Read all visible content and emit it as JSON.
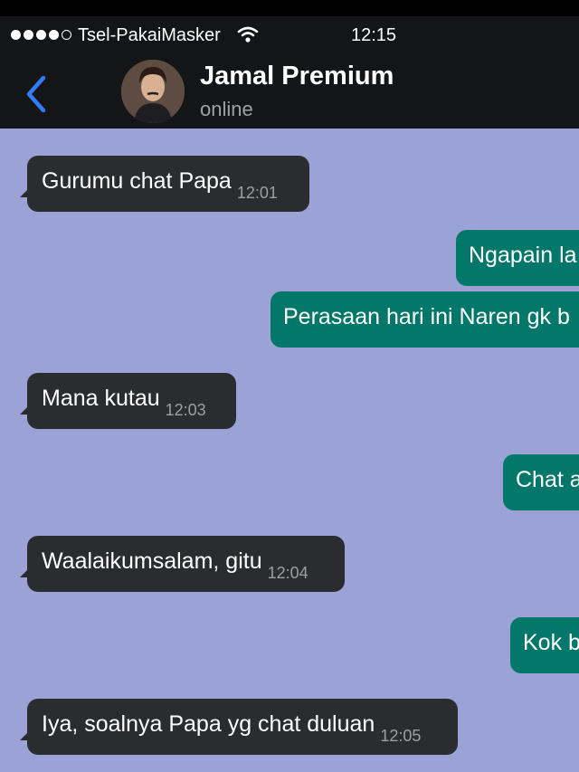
{
  "status_bar": {
    "carrier": "Tsel-PakaiMasker",
    "time": "12:15",
    "signal_bars_filled": 4,
    "signal_bars_total": 5
  },
  "header": {
    "back_icon": "chevron-left-icon",
    "contact_name": "Jamal Premium",
    "presence": "online",
    "accent_color": "#2f7cf6"
  },
  "colors": {
    "background": "#9ba2d6",
    "incoming_bubble": "#2b2c30",
    "outgoing_bubble": "#03786a"
  },
  "messages": [
    {
      "direction": "incoming",
      "text": "Gurumu chat Papa",
      "time": "12:01"
    },
    {
      "direction": "outgoing",
      "text": "Ngapain la",
      "time": ""
    },
    {
      "direction": "outgoing",
      "text": "Perasaan hari ini Naren gk b",
      "time": ""
    },
    {
      "direction": "incoming",
      "text": "Mana kutau",
      "time": "12:03"
    },
    {
      "direction": "outgoing",
      "text": "Chat a",
      "time": ""
    },
    {
      "direction": "incoming",
      "text": "Waalaikumsalam, gitu",
      "time": "12:04"
    },
    {
      "direction": "outgoing",
      "text": "Kok b",
      "time": ""
    },
    {
      "direction": "incoming",
      "text": "Iya, soalnya Papa yg chat duluan",
      "time": "12:05"
    }
  ]
}
